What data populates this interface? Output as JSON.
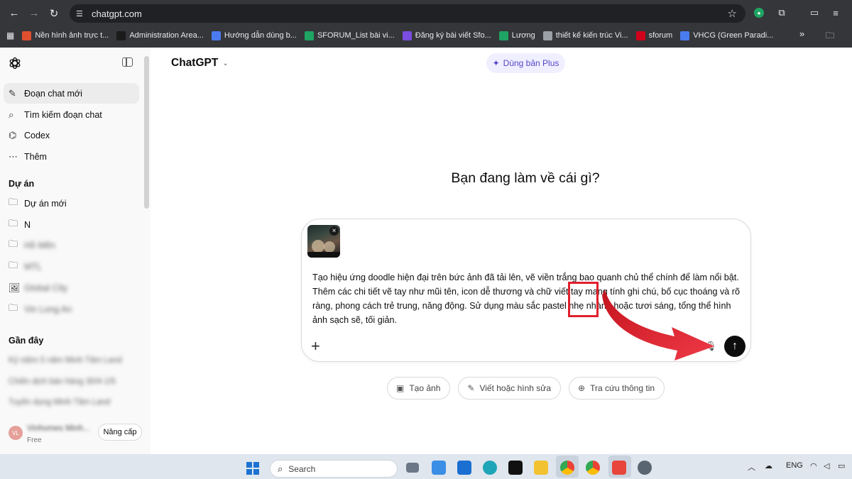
{
  "browser": {
    "url": "chatgpt.com",
    "bookmarks": [
      {
        "label": "Nền hình ảnh trực t...",
        "color": "#e04f2f"
      },
      {
        "label": "Administration Area...",
        "color": "#1b1b1b"
      },
      {
        "label": "Hướng dẫn dùng b...",
        "color": "#4a7cf0"
      },
      {
        "label": "SFORUM_List bài vi...",
        "color": "#1fa463"
      },
      {
        "label": "Đăng ký bài viết Sfo...",
        "color": "#7a4ce0"
      },
      {
        "label": "Lương",
        "color": "#1fa463"
      },
      {
        "label": "thiết kế kiến trúc Vi...",
        "color": "#9aa0a6"
      },
      {
        "label": "sforum",
        "color": "#d0021b"
      },
      {
        "label": "VHCG (Green Paradi...",
        "color": "#4a7cf0"
      }
    ],
    "bookmarks_more": "»",
    "all_bookmarks_icon": "folder-icon"
  },
  "sidebar": {
    "nav": [
      {
        "label": "Đoạn chat mới",
        "icon": "✎"
      },
      {
        "label": "Tìm kiếm đoạn chat",
        "icon": "⌕"
      },
      {
        "label": "Codex",
        "icon": "⌬"
      },
      {
        "label": "Thêm",
        "icon": "⋯"
      }
    ],
    "projects_title": "Dự án",
    "projects": [
      {
        "label": "Dự án mới",
        "icon": "🗀",
        "blurred": false
      },
      {
        "label": "N",
        "icon": "🗀",
        "blurred": false
      },
      {
        "label": "Hồ Mến",
        "icon": "🗀",
        "blurred": true
      },
      {
        "label": "MTL",
        "icon": "🗀",
        "blurred": true
      },
      {
        "label": "Global City",
        "icon": "🖼",
        "blurred": true
      },
      {
        "label": "Vin Long An",
        "icon": "🗀",
        "blurred": true
      }
    ],
    "recent_title": "Gần đây",
    "recent": [
      "Kỷ niệm 5 năm Minh Tâm Land",
      "Chiến dịch bán hàng 30/4-1/5",
      "Tuyển dụng Minh Tâm Land"
    ],
    "user": {
      "initials": "VL",
      "name": "Vinhomes Minh...",
      "plan": "Free",
      "upgrade_label": "Nâng cấp"
    }
  },
  "main": {
    "model": "ChatGPT",
    "plus_label": "Dùng bản Plus",
    "headline": "Bạn đang làm về cái gì?",
    "prompt_text": "Tạo hiệu ứng doodle hiện đại trên bức ảnh đã tải lên, vẽ viền trắng bao quanh chủ thể chính để làm nổi bật. Thêm các chi tiết vẽ tay như mũi tên, icon dễ thương và chữ viết tay mang tính ghi chú, bố cục thoáng và rõ ràng, phong cách trẻ trung, năng động. Sử dụng màu sắc pastel nhẹ nhàng hoặc tươi sáng, tổng thể hình ảnh sạch sẽ, tối giản.",
    "chips": [
      {
        "label": "Tạo ảnh",
        "icon": "▣"
      },
      {
        "label": "Viết hoặc hình sửa",
        "icon": "✎"
      },
      {
        "label": "Tra cứu thông tin",
        "icon": "⊕"
      }
    ],
    "annotation_color": "#e0202c"
  },
  "taskbar": {
    "search_placeholder": "Search",
    "language": "ENG"
  }
}
